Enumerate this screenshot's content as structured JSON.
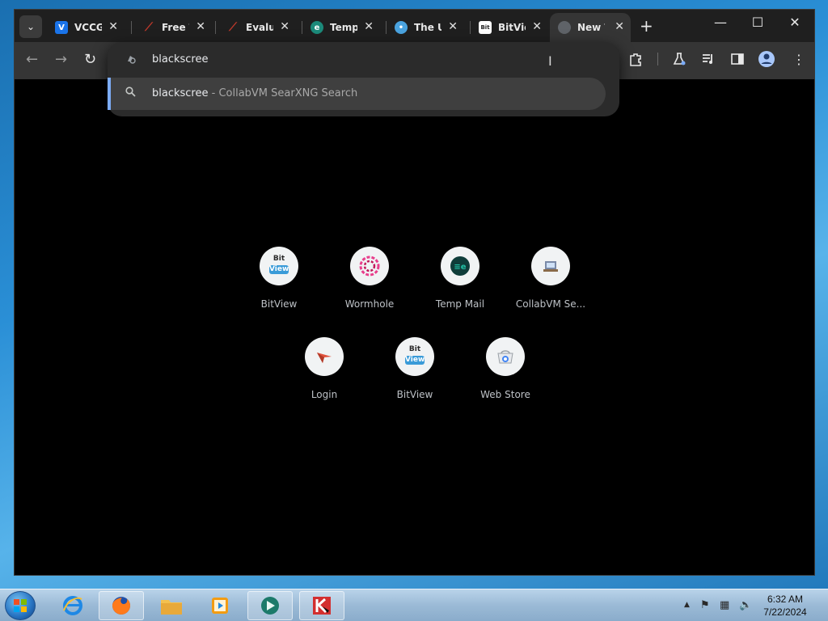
{
  "browser": {
    "tabs": [
      {
        "title": "VCCGr",
        "favicon": "V",
        "favicon_color": "#1a73e8"
      },
      {
        "title": "Free T",
        "favicon": "slash",
        "favicon_color": "#c0392b"
      },
      {
        "title": "Evalua",
        "favicon": "slash",
        "favicon_color": "#c0392b"
      },
      {
        "title": "Temp",
        "favicon": "temp-mail",
        "favicon_color": "#1c8a7a"
      },
      {
        "title": "The U",
        "favicon": "chat",
        "favicon_color": "#4aa3df"
      },
      {
        "title": "BitVie",
        "favicon": "bitview",
        "favicon_color": "#ffffff"
      },
      {
        "title": "New T",
        "favicon": "globe",
        "favicon_color": "#9aa0a6",
        "active": true
      }
    ],
    "close_glyph": "✕",
    "new_tab_glyph": "+",
    "window_controls": {
      "minimize": "—",
      "maximize": "☐",
      "close": "✕"
    }
  },
  "toolbar": {
    "back": "←",
    "forward": "→",
    "reload": "↻",
    "icons": [
      "extensions-icon",
      "labs-icon",
      "media-icon",
      "side-panel-icon",
      "profile-icon",
      "menu-icon"
    ]
  },
  "omnibox": {
    "typed_text": "blackscree",
    "suggestion_query": "blackscree",
    "suggestion_suffix": " - CollabVM SearXNG Search"
  },
  "shortcuts": [
    {
      "label": "BitView",
      "icon": "bitview"
    },
    {
      "label": "Wormhole",
      "icon": "wormhole"
    },
    {
      "label": "Temp Mail",
      "icon": "temp-mail"
    },
    {
      "label": "CollabVM Se...",
      "icon": "collabvm"
    },
    {
      "label": "Login",
      "icon": "login"
    },
    {
      "label": "BitView",
      "icon": "bitview"
    },
    {
      "label": "Web Store",
      "icon": "web-store"
    }
  ],
  "taskbar": {
    "clock_time": "6:32 AM",
    "clock_date": "7/22/2024"
  }
}
